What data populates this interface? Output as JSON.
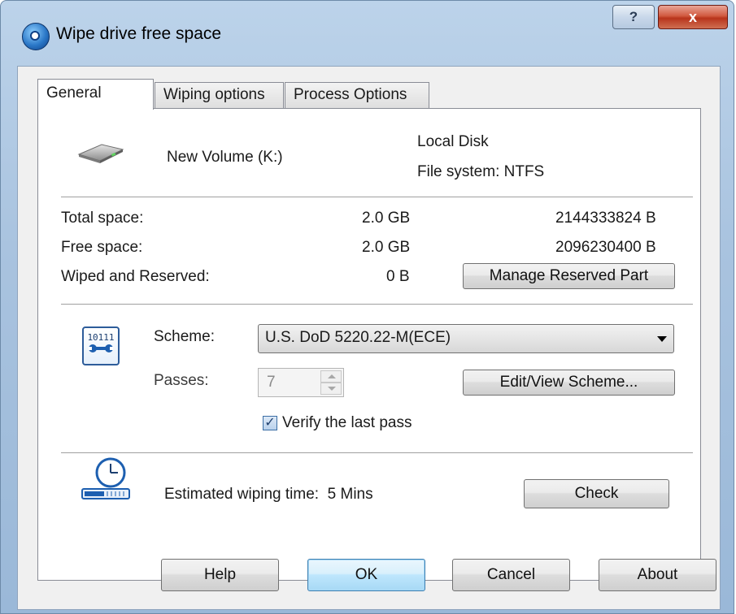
{
  "window": {
    "title": "Wipe drive free space",
    "help_label": "?",
    "close_label": "x"
  },
  "tabs": [
    {
      "label": "General",
      "active": true
    },
    {
      "label": "Wiping options",
      "active": false
    },
    {
      "label": "Process Options",
      "active": false
    }
  ],
  "drive": {
    "name": "New Volume (K:)",
    "type": "Local Disk",
    "file_system": "File system: NTFS"
  },
  "space": {
    "total_label": "Total space:",
    "total_size": "2.0 GB",
    "total_bytes": "2144333824 B",
    "free_label": "Free space:",
    "free_size": "2.0 GB",
    "free_bytes": "2096230400 B",
    "reserved_label": "Wiped and Reserved:",
    "reserved_size": "0 B",
    "manage_button": "Manage Reserved Part"
  },
  "scheme": {
    "icon_text": "10111",
    "scheme_label": "Scheme:",
    "scheme_value": "U.S. DoD 5220.22-M(ECE)",
    "passes_label": "Passes:",
    "passes_value": "7",
    "edit_button": "Edit/View Scheme...",
    "verify_label": "Verify the last pass",
    "verify_checked": true
  },
  "estimate": {
    "label": "Estimated wiping time:",
    "value": "5 Mins",
    "check_button": "Check"
  },
  "footer": {
    "help": "Help",
    "ok": "OK",
    "cancel": "Cancel",
    "about": "About"
  },
  "colors": {
    "accent": "#2d5c9a",
    "close_red": "#c8442a",
    "default_button": "#bee6fd"
  }
}
